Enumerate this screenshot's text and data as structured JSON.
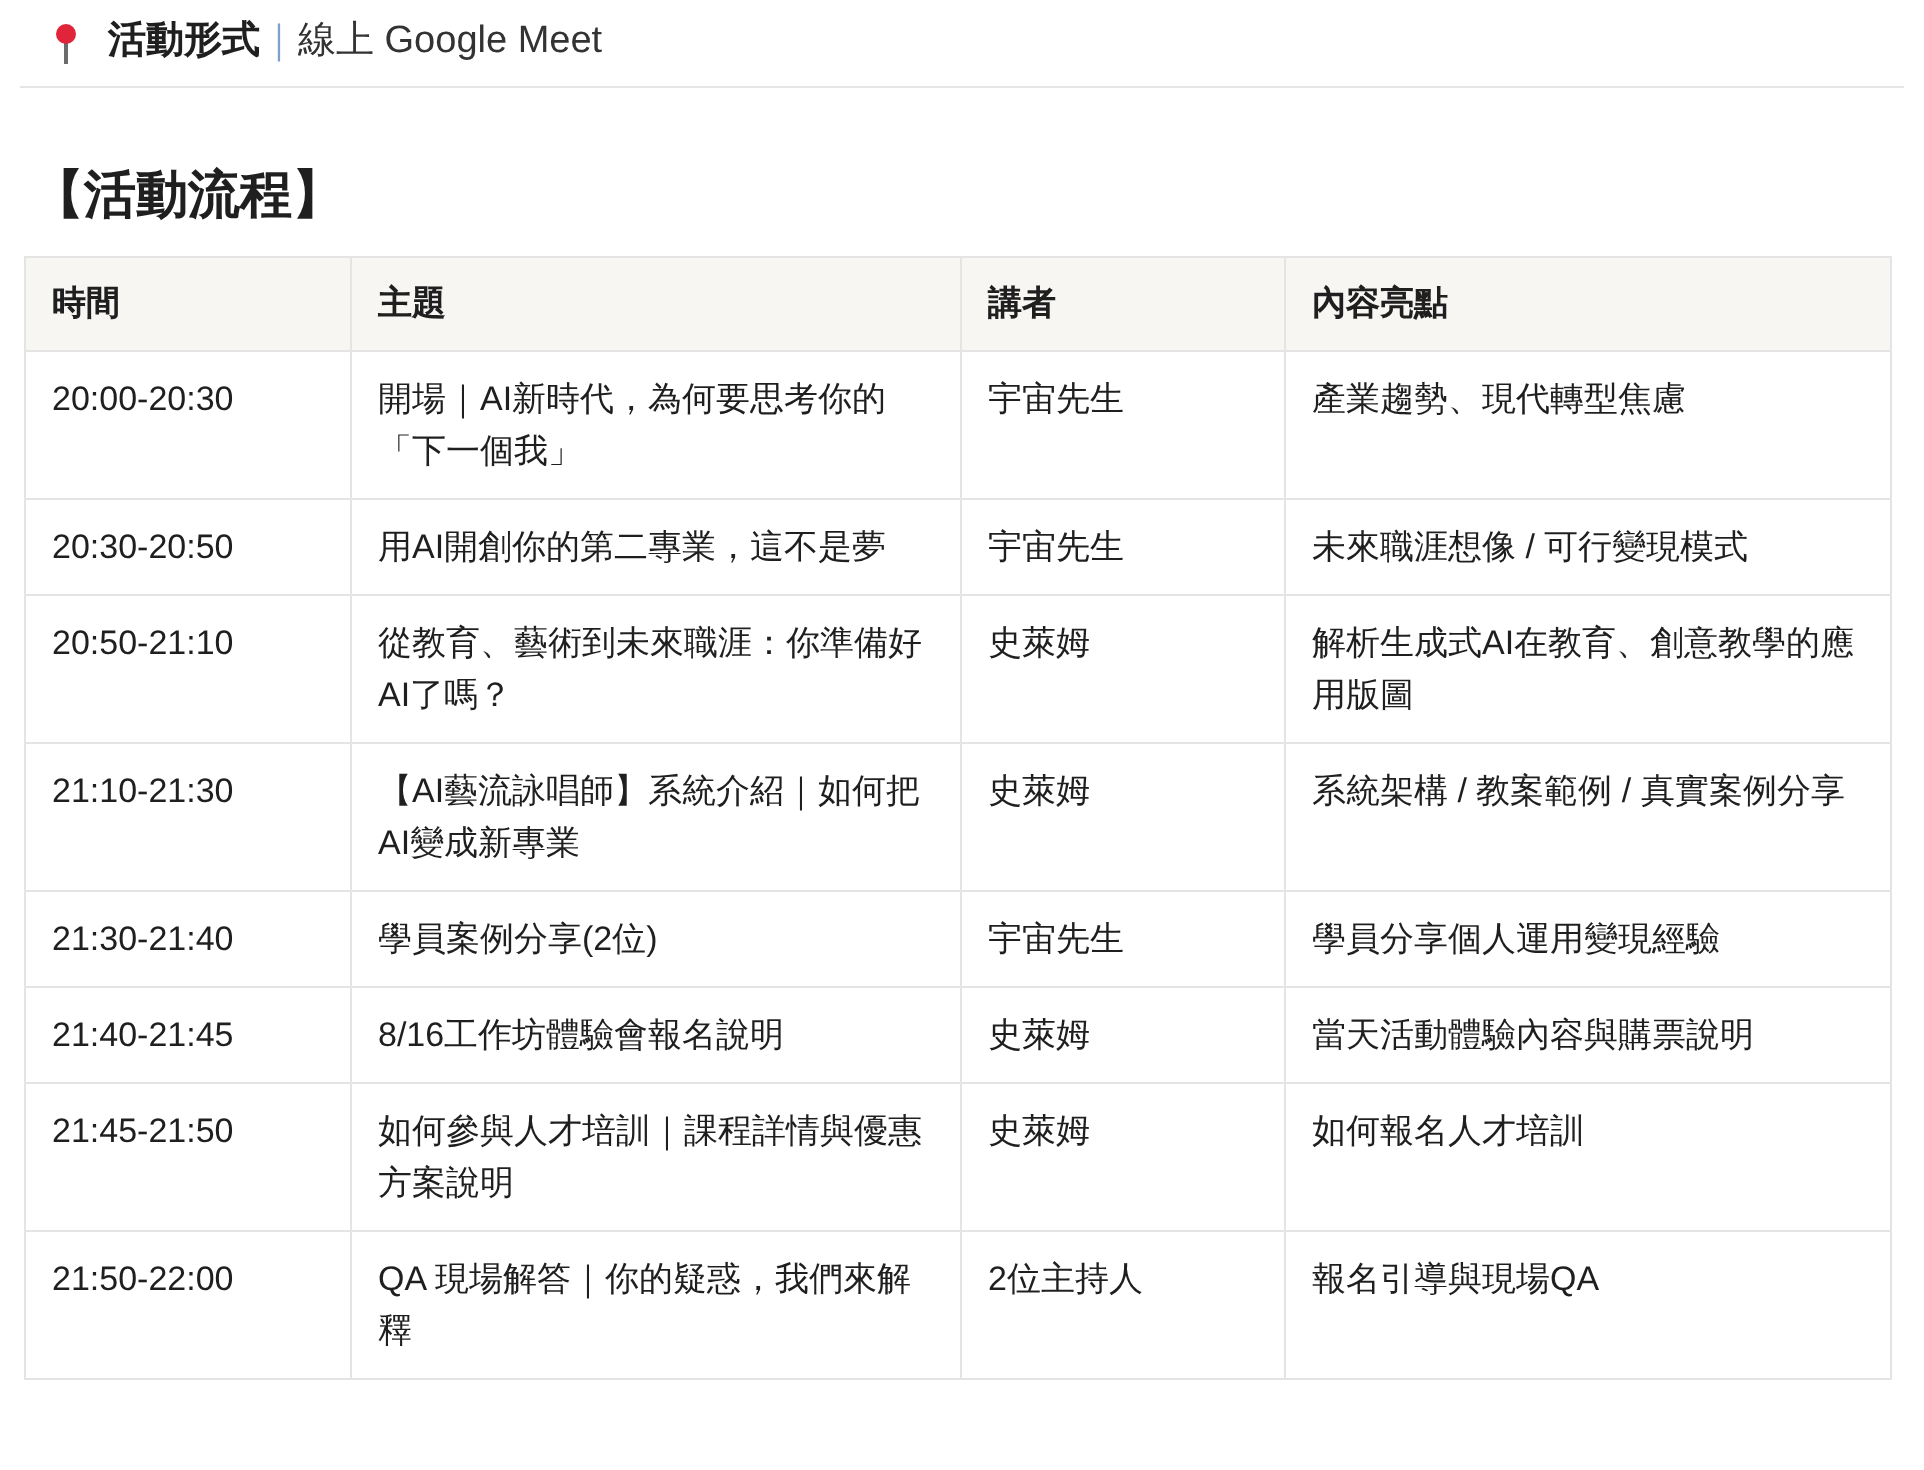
{
  "format_line": {
    "label": "活動形式",
    "separator": "｜",
    "value": "線上 Google Meet"
  },
  "section_title": "【活動流程】",
  "table": {
    "columns": [
      "時間",
      "主題",
      "講者",
      "內容亮點"
    ],
    "rows": [
      [
        "20:00-20:30",
        "開場｜AI新時代，為何要思考你的「下一個我」",
        "宇宙先生",
        "產業趨勢、現代轉型焦慮"
      ],
      [
        "20:30-20:50",
        "用AI開創你的第二專業，這不是夢",
        "宇宙先生",
        "未來職涯想像 / 可行變現模式"
      ],
      [
        "20:50-21:10",
        "從教育、藝術到未來職涯：你準備好AI了嗎？",
        "史萊姆",
        "解析生成式AI在教育、創意教學的應用版圖"
      ],
      [
        "21:10-21:30",
        "【AI藝流詠唱師】系統介紹｜如何把AI變成新專業",
        "史萊姆",
        "系統架構 / 教案範例 / 真實案例分享"
      ],
      [
        "21:30-21:40",
        "學員案例分享(2位)",
        "宇宙先生",
        "學員分享個人運用變現經驗"
      ],
      [
        "21:40-21:45",
        "8/16工作坊體驗會報名說明",
        "史萊姆",
        "當天活動體驗內容與購票說明"
      ],
      [
        "21:45-21:50",
        "如何參與人才培訓｜課程詳情與優惠方案說明",
        "史萊姆",
        "如何報名人才培訓"
      ],
      [
        "21:50-22:00",
        "QA 現場解答｜你的疑惑，我們來解釋",
        "2位主持人",
        "報名引導與現場QA"
      ]
    ]
  }
}
